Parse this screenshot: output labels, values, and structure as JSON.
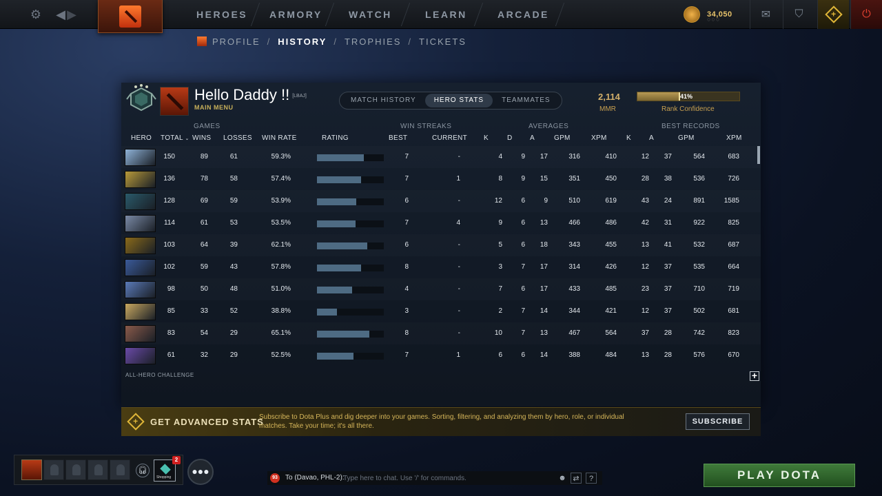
{
  "topbar": {
    "nav": [
      "HEROES",
      "ARMORY",
      "WATCH",
      "LEARN",
      "ARCADE"
    ],
    "gold": "34,050",
    "icons": [
      "settings-gear-icon",
      "back-arrow-icon",
      "forward-arrow-icon",
      "mail-icon",
      "armory-icon",
      "dota-plus-icon",
      "power-icon"
    ]
  },
  "subnav": {
    "items": [
      "PROFILE",
      "HISTORY",
      "TROPHIES",
      "TICKETS"
    ],
    "active": "HISTORY",
    "sep": "/"
  },
  "profile": {
    "name": "Hello Daddy !!",
    "tag": "[LBAJ]",
    "subtitle": "MAIN MENU",
    "tabs": [
      "MATCH HISTORY",
      "HERO STATS",
      "TEAMMATES"
    ],
    "active_tab": "HERO STATS",
    "mmr": "2,114",
    "mmr_label": "MMR",
    "confidence_pct": "41%",
    "confidence_value": 0.41,
    "confidence_label": "Rank Confidence"
  },
  "table": {
    "groups": {
      "games": "GAMES",
      "win_streaks": "WIN STREAKS",
      "averages": "AVERAGES",
      "best_records": "BEST RECORDS"
    },
    "columns": {
      "hero": "HERO",
      "total": "TOTAL",
      "wins": "WINS",
      "losses": "LOSSES",
      "win_rate": "WIN RATE",
      "rating": "RATING",
      "best": "BEST",
      "current": "CURRENT",
      "avg_k": "K",
      "avg_d": "D",
      "avg_a": "A",
      "avg_gpm": "GPM",
      "avg_xpm": "XPM",
      "rec_k": "K",
      "rec_a": "A",
      "rec_gpm": "GPM",
      "rec_xpm": "XPM"
    },
    "rows": [
      {
        "total": "150",
        "wins": "89",
        "losses": "61",
        "wr": "59.3%",
        "rating": 0.7,
        "best": "7",
        "cur": "-",
        "k": "4",
        "d": "9",
        "a": "17",
        "gpm": "316",
        "xpm": "410",
        "rk": "12",
        "ra": "37",
        "rgpm": "564",
        "rxpm": "683",
        "color": "#8fb3d8"
      },
      {
        "total": "136",
        "wins": "78",
        "losses": "58",
        "wr": "57.4%",
        "rating": 0.66,
        "best": "7",
        "cur": "1",
        "k": "8",
        "d": "9",
        "a": "15",
        "gpm": "351",
        "xpm": "450",
        "rk": "28",
        "ra": "38",
        "rgpm": "536",
        "rxpm": "726",
        "color": "#b89a3a"
      },
      {
        "total": "128",
        "wins": "69",
        "losses": "59",
        "wr": "53.9%",
        "rating": 0.59,
        "best": "6",
        "cur": "-",
        "k": "12",
        "d": "6",
        "a": "9",
        "gpm": "510",
        "xpm": "619",
        "rk": "43",
        "ra": "24",
        "rgpm": "891",
        "rxpm": "1585",
        "color": "#2a5a6a"
      },
      {
        "total": "114",
        "wins": "61",
        "losses": "53",
        "wr": "53.5%",
        "rating": 0.58,
        "best": "7",
        "cur": "4",
        "k": "9",
        "d": "6",
        "a": "13",
        "gpm": "466",
        "xpm": "486",
        "rk": "42",
        "ra": "31",
        "rgpm": "922",
        "rxpm": "825",
        "color": "#7a8aa6"
      },
      {
        "total": "103",
        "wins": "64",
        "losses": "39",
        "wr": "62.1%",
        "rating": 0.75,
        "best": "6",
        "cur": "-",
        "k": "5",
        "d": "6",
        "a": "18",
        "gpm": "343",
        "xpm": "455",
        "rk": "13",
        "ra": "41",
        "rgpm": "532",
        "rxpm": "687",
        "color": "#8a6a1a"
      },
      {
        "total": "102",
        "wins": "59",
        "losses": "43",
        "wr": "57.8%",
        "rating": 0.66,
        "best": "8",
        "cur": "-",
        "k": "3",
        "d": "7",
        "a": "17",
        "gpm": "314",
        "xpm": "426",
        "rk": "12",
        "ra": "37",
        "rgpm": "535",
        "rxpm": "664",
        "color": "#3a5a9a"
      },
      {
        "total": "98",
        "wins": "50",
        "losses": "48",
        "wr": "51.0%",
        "rating": 0.53,
        "best": "4",
        "cur": "-",
        "k": "7",
        "d": "6",
        "a": "17",
        "gpm": "433",
        "xpm": "485",
        "rk": "23",
        "ra": "37",
        "rgpm": "710",
        "rxpm": "719",
        "color": "#5a7ab8"
      },
      {
        "total": "85",
        "wins": "33",
        "losses": "52",
        "wr": "38.8%",
        "rating": 0.3,
        "best": "3",
        "cur": "-",
        "k": "2",
        "d": "7",
        "a": "14",
        "gpm": "344",
        "xpm": "421",
        "rk": "12",
        "ra": "37",
        "rgpm": "502",
        "rxpm": "681",
        "color": "#c8a860"
      },
      {
        "total": "83",
        "wins": "54",
        "losses": "29",
        "wr": "65.1%",
        "rating": 0.78,
        "best": "8",
        "cur": "-",
        "k": "10",
        "d": "7",
        "a": "13",
        "gpm": "467",
        "xpm": "564",
        "rk": "37",
        "ra": "28",
        "rgpm": "742",
        "rxpm": "823",
        "color": "#8a5a4a"
      },
      {
        "total": "61",
        "wins": "32",
        "losses": "29",
        "wr": "52.5%",
        "rating": 0.55,
        "best": "7",
        "cur": "1",
        "k": "6",
        "d": "6",
        "a": "14",
        "gpm": "388",
        "xpm": "484",
        "rk": "13",
        "ra": "28",
        "rgpm": "576",
        "rxpm": "670",
        "color": "#6a4aa8"
      }
    ],
    "footer": "ALL-HERO CHALLENGE",
    "expand_symbol": "+"
  },
  "advanced": {
    "title": "GET ADVANCED STATS",
    "desc": "Subscribe to Dota Plus and dig deeper into your games. Sorting, filtering, and analyzing them by hero, role, or individual matches. Take your time; it's all there.",
    "button": "SUBSCRIBE"
  },
  "bottom": {
    "inventory_badge": "2",
    "inventory_label": "Shopping",
    "chat_badge": "93",
    "chat_to": "To (Davao, PHL-2):",
    "chat_placeholder": "Type here to chat. Use '/' for commands.",
    "chat_help": "?",
    "play": "PLAY DOTA"
  }
}
